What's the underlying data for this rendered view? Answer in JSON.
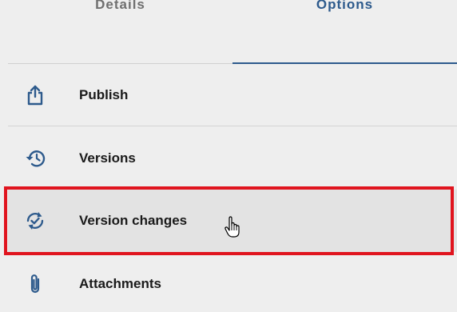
{
  "tabs": {
    "details": "Details",
    "options": "Options",
    "active": "options"
  },
  "options": {
    "items": [
      {
        "label": "Publish",
        "icon": "publish-icon"
      },
      {
        "label": "Versions",
        "icon": "history-icon"
      },
      {
        "label": "Version changes",
        "icon": "sync-check-icon"
      },
      {
        "label": "Attachments",
        "icon": "paperclip-icon"
      }
    ],
    "highlighted": "Version changes"
  },
  "colors": {
    "accent": "#2d5a8c",
    "highlight_border": "#e0141e",
    "background": "#eeeeee"
  }
}
